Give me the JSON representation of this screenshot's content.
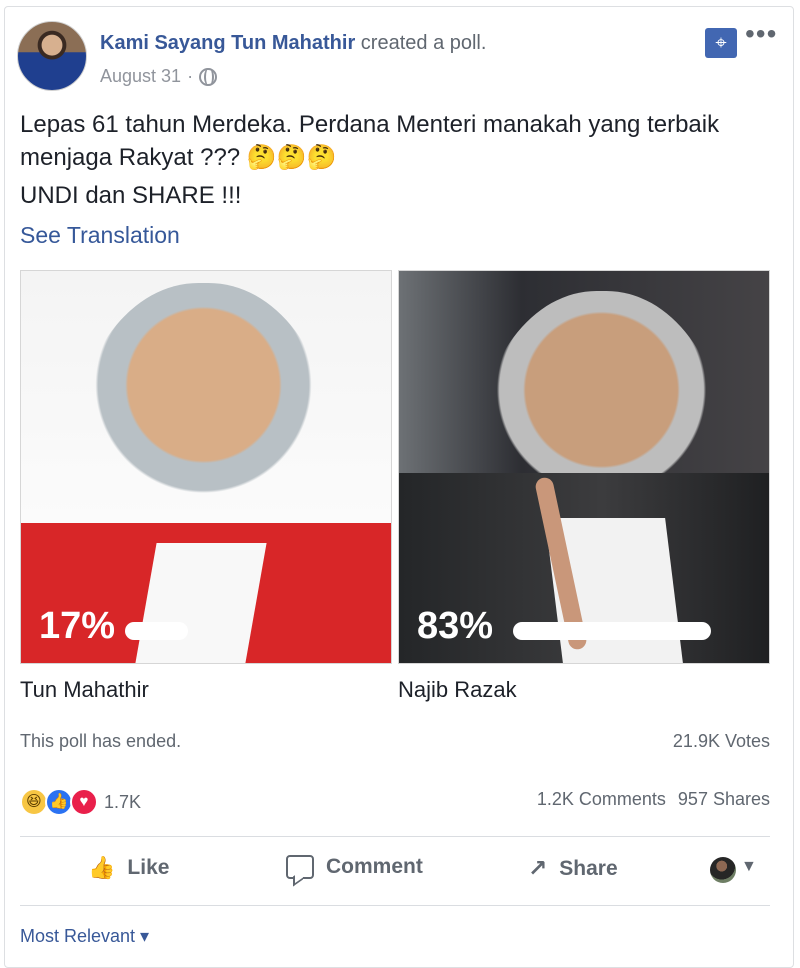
{
  "post": {
    "author": "Kami Sayang Tun Mahathir",
    "action": "created a poll.",
    "date": "August 31",
    "date_separator": "·",
    "text_line_1": "Lepas 61 tahun Merdeka. Perdana Menteri manakah yang terbaik",
    "text_line_2": "menjaga Rakyat ???",
    "emojis": "🤔🤔🤔",
    "text_line_3": "UNDI dan SHARE !!!",
    "see_translation": "See Translation"
  },
  "poll": {
    "options": [
      {
        "name": "Tun Mahathir",
        "percent_label": "17%",
        "percent": 17
      },
      {
        "name": "Najib Razak",
        "percent_label": "83%",
        "percent": 83
      }
    ],
    "status": "This poll has ended.",
    "votes": "21.9K Votes"
  },
  "engagement": {
    "reaction_count": "1.7K",
    "comments": "1.2K Comments",
    "shares": "957 Shares"
  },
  "actions": {
    "like": "Like",
    "comment": "Comment",
    "share": "Share"
  },
  "footer": {
    "most_relevant": "Most Relevant ▾"
  },
  "icons": {
    "pin": "pin-icon",
    "more": "more-icon",
    "globe": "globe-icon",
    "like": "like-icon",
    "comment": "comment-icon",
    "share": "share-icon",
    "haha": "haha-reaction-icon",
    "like_reaction": "like-reaction-icon",
    "love": "love-reaction-icon"
  },
  "colors": {
    "brand_blue": "#385898",
    "pin_blue": "#4267b2",
    "divider": "#dadde1",
    "muted_text": "#606770"
  }
}
